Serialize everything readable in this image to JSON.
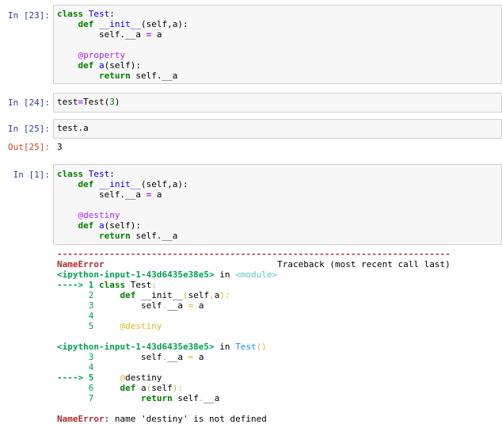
{
  "cells": [
    {
      "prompt": "In [23]:",
      "code": [
        [
          [
            "kw",
            "class"
          ],
          [
            "t",
            " "
          ],
          [
            "nm",
            "Test"
          ],
          [
            "t",
            ":"
          ]
        ],
        [
          [
            "t",
            "    "
          ],
          [
            "kw",
            "def"
          ],
          [
            "t",
            " "
          ],
          [
            "nm",
            "__init__"
          ],
          [
            "t",
            "(self,a):"
          ]
        ],
        [
          [
            "t",
            "        self.__a "
          ],
          [
            "op",
            "="
          ],
          [
            "t",
            " a"
          ]
        ],
        [
          [
            "t",
            ""
          ]
        ],
        [
          [
            "t",
            "    "
          ],
          [
            "dec",
            "@property"
          ]
        ],
        [
          [
            "t",
            "    "
          ],
          [
            "kw",
            "def"
          ],
          [
            "t",
            " "
          ],
          [
            "nm",
            "a"
          ],
          [
            "t",
            "(self):"
          ]
        ],
        [
          [
            "t",
            "        "
          ],
          [
            "kw",
            "return"
          ],
          [
            "t",
            " self.__a"
          ]
        ]
      ]
    },
    {
      "prompt": "In [24]:",
      "code": [
        [
          [
            "t",
            "test"
          ],
          [
            "op",
            "="
          ],
          [
            "t",
            "Test("
          ],
          [
            "num",
            "3"
          ],
          [
            "t",
            ")"
          ]
        ]
      ]
    },
    {
      "prompt": "In [25]:",
      "code": [
        [
          [
            "t",
            "test.a"
          ]
        ]
      ]
    },
    {
      "prompt": "In [1]:",
      "code": [
        [
          [
            "kw",
            "class"
          ],
          [
            "t",
            " "
          ],
          [
            "nm",
            "Test"
          ],
          [
            "t",
            ":"
          ]
        ],
        [
          [
            "t",
            "    "
          ],
          [
            "kw",
            "def"
          ],
          [
            "t",
            " "
          ],
          [
            "nm",
            "__init__"
          ],
          [
            "t",
            "(self,a):"
          ]
        ],
        [
          [
            "t",
            "        self.__a "
          ],
          [
            "op",
            "="
          ],
          [
            "t",
            " a"
          ]
        ],
        [
          [
            "t",
            ""
          ]
        ],
        [
          [
            "t",
            "    "
          ],
          [
            "dec",
            "@destiny"
          ]
        ],
        [
          [
            "t",
            "    "
          ],
          [
            "kw",
            "def"
          ],
          [
            "t",
            " "
          ],
          [
            "nm",
            "a"
          ],
          [
            "t",
            "(self):"
          ]
        ],
        [
          [
            "t",
            "        "
          ],
          [
            "kw",
            "return"
          ],
          [
            "t",
            " self.__a"
          ]
        ]
      ]
    }
  ],
  "output": {
    "prompt": "Out[25]:",
    "value": "3"
  },
  "traceback": [
    [
      [
        "red",
        "---------------------------------------------------------------------------"
      ]
    ],
    [
      [
        "red",
        "NameError"
      ],
      [
        "t",
        "                                 Traceback (most recent call last)"
      ]
    ],
    [
      [
        "grnb",
        "<ipython-input-1-43d6435e38e5>"
      ],
      [
        "t",
        " in "
      ],
      [
        "cyan",
        "<module>"
      ]
    ],
    [
      [
        "grnb",
        "----> 1 "
      ],
      [
        "kw",
        "class"
      ],
      [
        "t",
        " Test"
      ],
      [
        "yel",
        ":"
      ]
    ],
    [
      [
        "grn",
        "      2"
      ],
      [
        "t",
        "     "
      ],
      [
        "kw",
        "def"
      ],
      [
        "t",
        " __init__"
      ],
      [
        "yel",
        "("
      ],
      [
        "t",
        "self"
      ],
      [
        "yel",
        ","
      ],
      [
        "t",
        "a"
      ],
      [
        "yel",
        "):"
      ]
    ],
    [
      [
        "grn",
        "      3"
      ],
      [
        "t",
        "         self"
      ],
      [
        "yel",
        "."
      ],
      [
        "t",
        "__a "
      ],
      [
        "yel",
        "="
      ],
      [
        "t",
        " a"
      ]
    ],
    [
      [
        "grn",
        "      4"
      ]
    ],
    [
      [
        "grn",
        "      5"
      ],
      [
        "t",
        "     "
      ],
      [
        "yel",
        "@destiny"
      ]
    ],
    [
      [
        "t",
        ""
      ]
    ],
    [
      [
        "grnb",
        "<ipython-input-1-43d6435e38e5>"
      ],
      [
        "t",
        " in "
      ],
      [
        "cyanf",
        "Test"
      ],
      [
        "yel",
        "()"
      ]
    ],
    [
      [
        "grn",
        "      3"
      ],
      [
        "t",
        "         self"
      ],
      [
        "yel",
        "."
      ],
      [
        "t",
        "__a "
      ],
      [
        "yel",
        "="
      ],
      [
        "t",
        " a"
      ]
    ],
    [
      [
        "grn",
        "      4"
      ]
    ],
    [
      [
        "grnb",
        "----> 5"
      ],
      [
        "t",
        "     "
      ],
      [
        "yel",
        "@"
      ],
      [
        "t",
        "destiny"
      ]
    ],
    [
      [
        "grn",
        "      6"
      ],
      [
        "t",
        "     "
      ],
      [
        "kw",
        "def"
      ],
      [
        "t",
        " a"
      ],
      [
        "yel",
        "("
      ],
      [
        "t",
        "self"
      ],
      [
        "yel",
        "):"
      ]
    ],
    [
      [
        "grn",
        "      7"
      ],
      [
        "t",
        "         "
      ],
      [
        "kw",
        "return"
      ],
      [
        "t",
        " self"
      ],
      [
        "yel",
        "."
      ],
      [
        "t",
        "__a"
      ]
    ],
    [
      [
        "t",
        ""
      ]
    ],
    [
      [
        "red",
        "NameError"
      ],
      [
        "t",
        ": name 'destiny' is not defined"
      ]
    ]
  ]
}
